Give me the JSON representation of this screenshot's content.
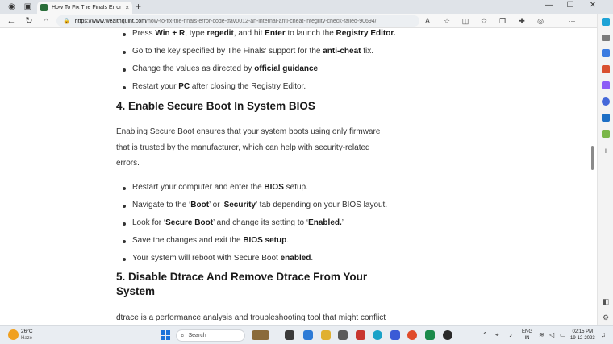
{
  "browser": {
    "tab_title": "How To Fix The Finals Error Code",
    "tab_close": "×",
    "new_tab": "+",
    "url_host": "https://www.wealthquint.com",
    "url_path": "/how-to-fix-the-finals-error-code-tfav0012-an-internal-anti-cheat-integrity-check-failed-90694/",
    "window_controls": [
      "—",
      "☐",
      "✕"
    ],
    "nav_icons": [
      "back-arrow-icon",
      "refresh-icon",
      "home-icon"
    ],
    "toolbar_icons": [
      "read-aloud-icon",
      "favorite-star-icon",
      "split-screen-icon",
      "favorites-icon",
      "collections-icon",
      "extensions-icon",
      "profile-icon",
      "more-icon"
    ]
  },
  "article": {
    "list1": [
      {
        "pre": "Press ",
        "b1": "Win + R",
        "mid": ", type ",
        "b2": "regedit",
        "mid2": ", and hit ",
        "b3": "Enter",
        "mid3": " to launch the ",
        "b4": "Registry Editor."
      },
      {
        "pre": "Go to the key specified by The Finals’ support for the ",
        "b1": "anti-cheat",
        "post": " fix."
      },
      {
        "pre": "Change the values as directed by ",
        "b1": "official guidance",
        "post": "."
      },
      {
        "pre": "Restart your ",
        "b1": "PC",
        "post": " after closing the Registry Editor."
      }
    ],
    "heading4": "4. Enable Secure Boot In System BIOS",
    "para4": [
      "Enabling Secure Boot ensures that your system boots using only firmware",
      "that is trusted by the manufacturer, which can help with security-related",
      "errors."
    ],
    "list2": [
      {
        "pre": "Restart your computer and enter the ",
        "b1": "BIOS",
        "post": " setup."
      },
      {
        "pre": "Navigate to the ‘",
        "b1": "Boot",
        "mid": "’ or ‘",
        "b2": "Security",
        "post": "’ tab depending on your BIOS layout."
      },
      {
        "pre": "Look for ‘",
        "b1": "Secure Boot",
        "mid": "’ and change its setting to ‘",
        "b2": "Enabled.",
        "post": "’"
      },
      {
        "pre": "Save the changes and exit the ",
        "b1": "BIOS setup",
        "post": "."
      },
      {
        "pre": "Your system will reboot with Secure Boot ",
        "b1": "enabled",
        "post": "."
      }
    ],
    "heading5_line1": "5. Disable Dtrace And Remove Dtrace From Your",
    "heading5_line2": "System",
    "para5": "dtrace is a performance analysis and troubleshooting tool that might conflict"
  },
  "taskbar": {
    "temperature": "26°C",
    "weather": "Haze",
    "search_label": "Search",
    "lang_line1": "ENG",
    "lang_line2": "IN",
    "time": "02:15 PM",
    "date": "19-12-2023"
  }
}
